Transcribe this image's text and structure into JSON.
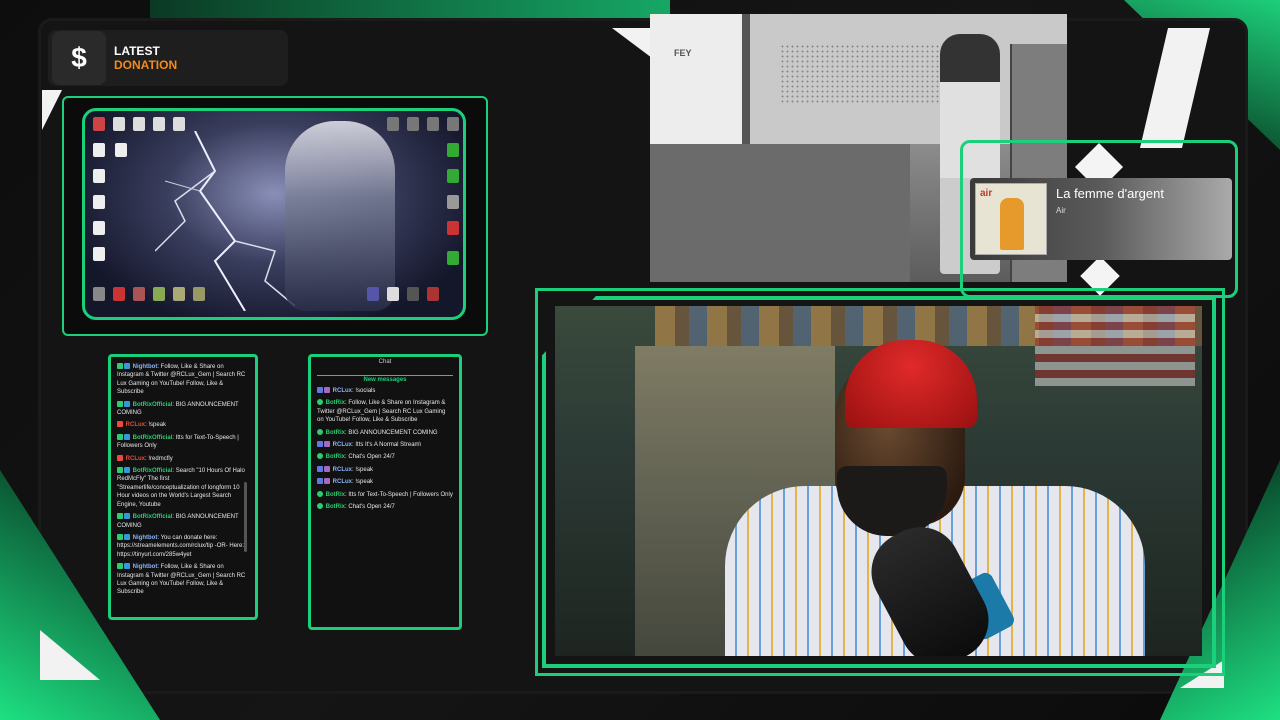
{
  "donation": {
    "icon": "dollar-icon",
    "icon_glyph": "$",
    "line1": "LATEST",
    "line2": "DONATION"
  },
  "now_playing": {
    "title": "La femme d'argent",
    "artist": "Air",
    "album_art_text": "air"
  },
  "office_photo": {
    "door_text": "FEY"
  },
  "chat_left": {
    "messages": [
      {
        "user": "Nightbot",
        "text": "Follow, Like & Share on Instagram & Twitter @RCLux_Gem | Search RC Lux Gaming on YouTube! Follow, Like & Subscribe",
        "color": "#8ab4f8"
      },
      {
        "user": "BotRixOfficial",
        "text": "BIG ANNOUNCEMENT COMING",
        "color": "#2ecc71"
      },
      {
        "user": "RCLux",
        "text": "!speak",
        "color": "#e74c3c"
      },
      {
        "user": "BotRixOfficial",
        "text": "Itts for Text-To-Speech | Followers Only",
        "color": "#2ecc71"
      },
      {
        "user": "RCLux",
        "text": "!redmcfly",
        "color": "#e74c3c"
      },
      {
        "user": "BotRixOfficial",
        "text": "Search \"10 Hours Of Halo RedMcFly\" The first \"Streamerlife/conceptualization of longform 10 Hour videos on the World's Largest Search Engine, Youtube",
        "color": "#2ecc71"
      },
      {
        "user": "BotRixOfficial",
        "text": "BIG ANNOUNCEMENT COMING",
        "color": "#2ecc71"
      },
      {
        "user": "Nightbot",
        "text": "You can donate here: https://streamelements.com/rclux/tip -OR- Here: https://tinyurl.com/285w4yet",
        "color": "#8ab4f8"
      },
      {
        "user": "Nightbot",
        "text": "Follow, Like & Share on Instagram & Twitter @RCLux_Gem | Search RC Lux Gaming on YouTube! Follow, Like & Subscribe",
        "color": "#8ab4f8"
      }
    ]
  },
  "chat_right": {
    "title": "Chat",
    "new_messages_label": "New messages",
    "messages": [
      {
        "user": "RCLux",
        "text": "!socials",
        "color": "#8ab4f8"
      },
      {
        "user": "BotRix",
        "text": "Follow, Like & Share on Instagram & Twitter @RCLux_Gem | Search RC Lux Gaming on YouTube! Follow, Like & Subscribe",
        "color": "#2ecc71"
      },
      {
        "user": "BotRix",
        "text": "BIG ANNOUNCEMENT COMING",
        "color": "#2ecc71"
      },
      {
        "user": "RCLux",
        "text": "Itts It's A Normal Stream\\",
        "color": "#8ab4f8"
      },
      {
        "user": "BotRix",
        "text": "Chat's Open 24/7",
        "color": "#2ecc71"
      },
      {
        "user": "RCLux",
        "text": "!speak",
        "color": "#8ab4f8"
      },
      {
        "user": "RCLux",
        "text": "!speak",
        "color": "#8ab4f8"
      },
      {
        "user": "BotRix",
        "text": "Itts for Text-To-Speech | Followers Only",
        "color": "#2ecc71"
      },
      {
        "user": "BotRix",
        "text": "Chat's Open 24/7",
        "color": "#2ecc71"
      }
    ]
  },
  "colors": {
    "accent": "#1ad07a",
    "donation_orange": "#f28a1c"
  }
}
